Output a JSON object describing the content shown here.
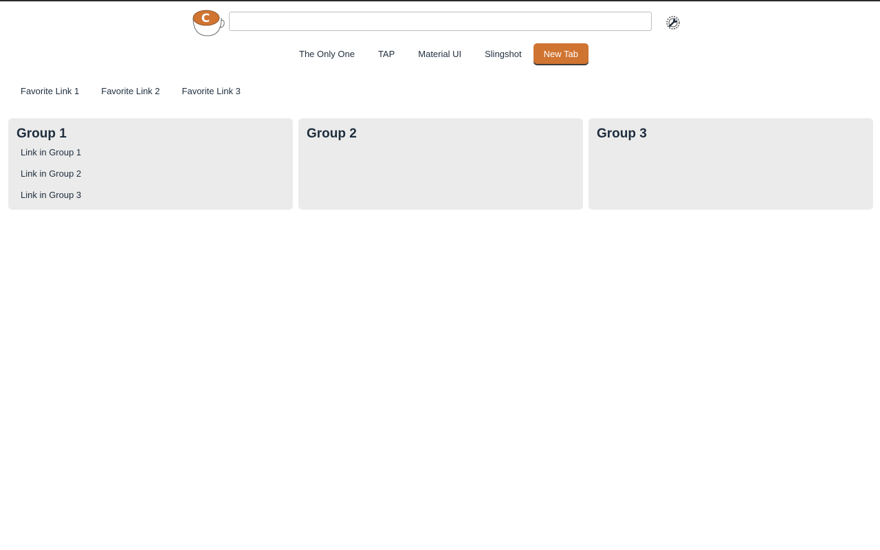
{
  "search": {
    "value": "",
    "placeholder": ""
  },
  "tabs": [
    {
      "label": "The Only One",
      "active": false
    },
    {
      "label": "TAP",
      "active": false
    },
    {
      "label": "Material UI",
      "active": false
    },
    {
      "label": "Slingshot",
      "active": false
    },
    {
      "label": "New Tab",
      "active": true
    }
  ],
  "favorites": [
    {
      "label": "Favorite Link 1"
    },
    {
      "label": "Favorite Link 2"
    },
    {
      "label": "Favorite Link 3"
    }
  ],
  "groups": [
    {
      "title": "Group 1",
      "links": [
        "Link in Group 1",
        "Link in Group 2",
        "Link in Group 3"
      ]
    },
    {
      "title": "Group 2",
      "links": []
    },
    {
      "title": "Group 3",
      "links": []
    }
  ],
  "icons": {
    "logo": "coffee-cup-logo-icon",
    "settings": "settings-wrench-icon"
  },
  "colors": {
    "accent": "#d07431",
    "text": "#1e2d3d",
    "panel": "#ebebeb"
  }
}
